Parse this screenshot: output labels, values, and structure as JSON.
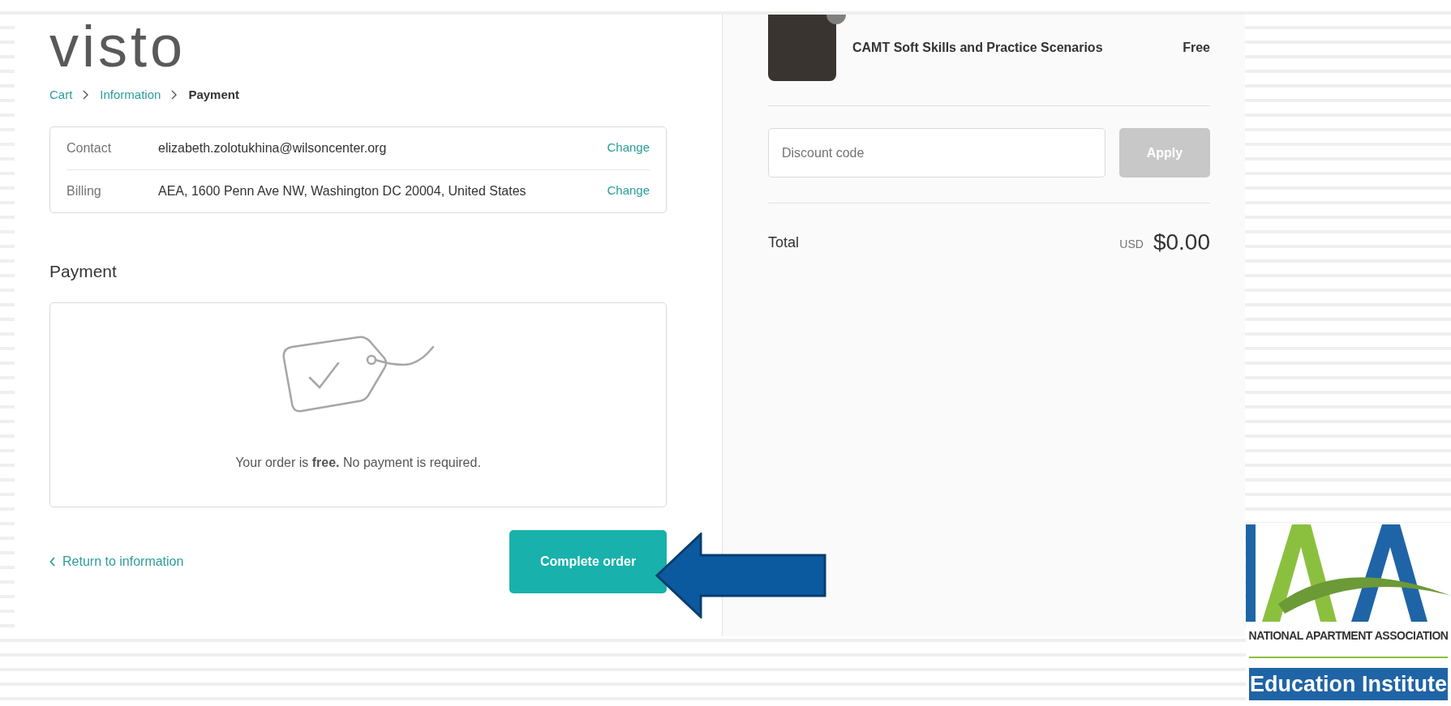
{
  "logo": "visto",
  "breadcrumb": [
    {
      "label": "Cart",
      "selected": false
    },
    {
      "label": "Information",
      "selected": false
    },
    {
      "label": "Payment",
      "selected": true
    }
  ],
  "review": [
    {
      "label": "Contact",
      "value": "elizabeth.zolotukhina@wilsoncenter.org",
      "action": "Change"
    },
    {
      "label": "Billing",
      "value": "AEA, 1600 Penn Ave NW, Washington DC 20004, United States",
      "action": "Change"
    }
  ],
  "payment": {
    "heading": "Payment",
    "message": "Your order is **free.** No payment is required."
  },
  "return_link": "Return to information",
  "complete_button": "Complete order",
  "order_summary": {
    "product": {
      "name": "CAMT Soft Skills and Practice Scenarios",
      "price": "Free"
    },
    "discount": {
      "placeholder": "Discount code",
      "button": "Apply",
      "disabled": true
    },
    "total": {
      "label": "Total",
      "currency": "USD",
      "amount": "$0.00"
    }
  },
  "brand_logo": {
    "line_1": "NATIONAL APARTMENT ASSOCIATION",
    "line_2": "Education Institute"
  }
}
